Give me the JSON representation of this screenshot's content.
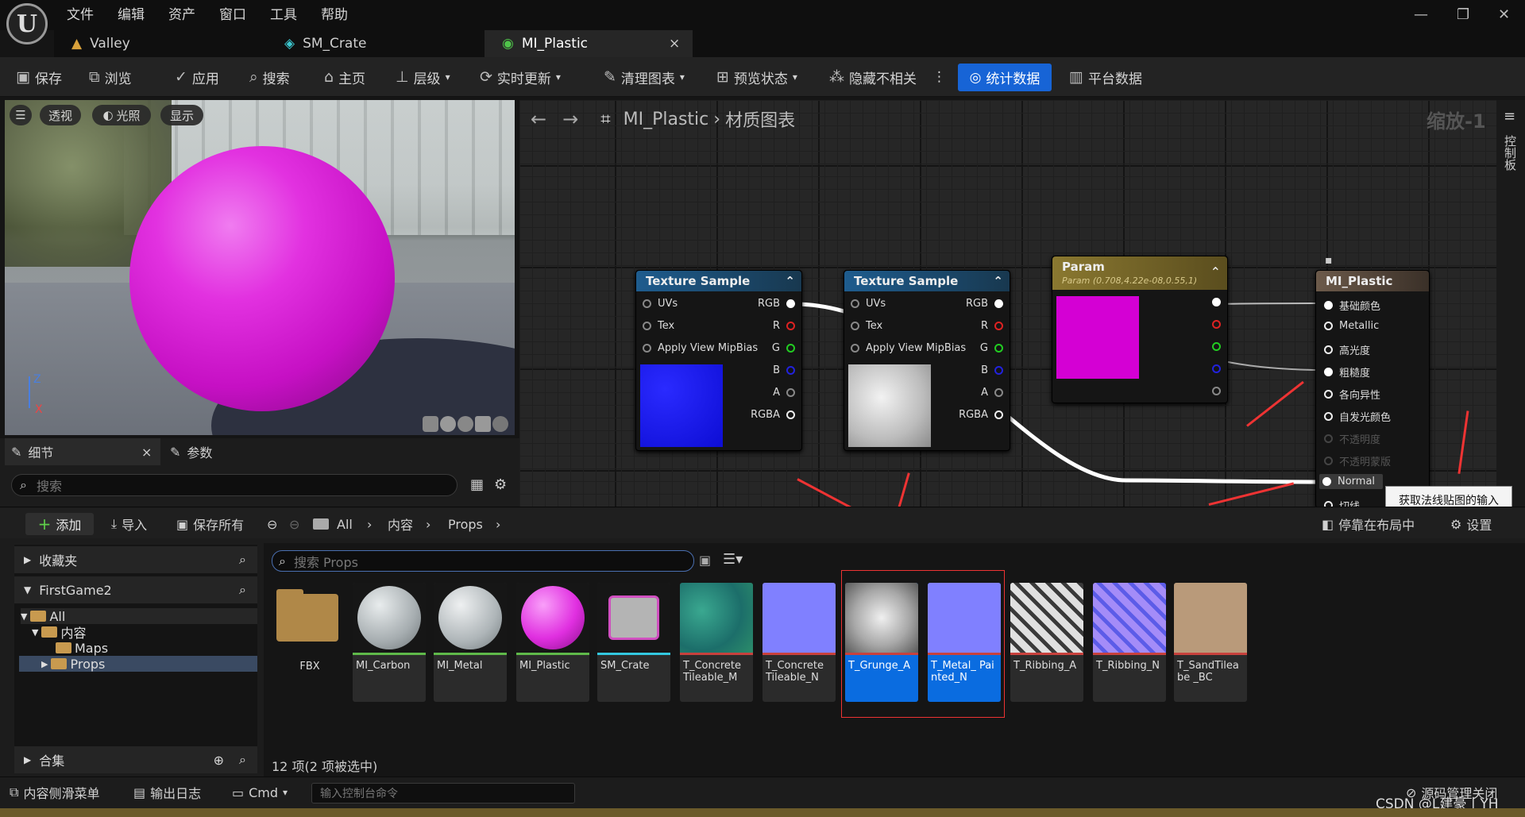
{
  "menu": [
    "文件",
    "编辑",
    "资产",
    "窗口",
    "工具",
    "帮助"
  ],
  "tabs": [
    {
      "label": "Valley",
      "icon": "level-icon"
    },
    {
      "label": "SM_Crate",
      "icon": "static-mesh-icon"
    },
    {
      "label": "MI_Plastic",
      "icon": "material-instance-icon",
      "close": "×"
    }
  ],
  "toolbar": {
    "save": "保存",
    "browse": "浏览",
    "apply": "应用",
    "search": "搜索",
    "home": "主页",
    "hierarchy": "层级",
    "live_update": "实时更新",
    "clean_graph": "清理图表",
    "preview_state": "预览状态",
    "hide_unrelated": "隐藏不相关",
    "more": "⋮",
    "stats": "统计数据",
    "platform_stats": "平台数据"
  },
  "viewport": {
    "menu": "☰",
    "perspective": "透视",
    "lighting": "光照",
    "show": "显示",
    "axis_z": "Z",
    "axis_x": "X"
  },
  "details": {
    "tab": "细节",
    "close": "×",
    "params_tab": "参数",
    "search_placeholder": "搜索"
  },
  "graph": {
    "breadcrumb_asset": "MI_Plastic",
    "breadcrumb_sep": "›",
    "breadcrumb_graph": "材质图表",
    "zoom": "缩放-1",
    "side_label": "控制板",
    "nodes": [
      {
        "title": "Texture Sample",
        "inputs": [
          "UVs",
          "Tex",
          "Apply View MipBias"
        ],
        "outputs": [
          "RGB",
          "R",
          "G",
          "B",
          "A",
          "RGBA"
        ],
        "preview": "#1414e6"
      },
      {
        "title": "Texture Sample",
        "inputs": [
          "UVs",
          "Tex",
          "Apply View MipBias"
        ],
        "outputs": [
          "RGB",
          "R",
          "G",
          "B",
          "A",
          "RGBA"
        ],
        "preview": "#d8d8d8"
      },
      {
        "title": "Param",
        "subtitle": "Param (0.708,4.22e-08,0.55,1)",
        "preview": "#d400d4"
      },
      {
        "title": "MI_Plastic",
        "inputs": [
          "基础颜色",
          "Metallic",
          "高光度",
          "粗糙度",
          "各向异性",
          "自发光颜色",
          "不透明度",
          "不透明蒙版",
          "Normal",
          "切线"
        ]
      }
    ]
  },
  "tooltip": "获取法线贴图的输入",
  "content_browser": {
    "add": "添加",
    "import": "导入",
    "save_all": "保存所有",
    "path": [
      "All",
      "内容",
      "Props"
    ],
    "path_sep": "›",
    "dock": "停靠在布局中",
    "settings": "设置",
    "favorites": "收藏夹",
    "project": "FirstGame2",
    "tree": [
      "All",
      "内容",
      "Maps",
      "Props"
    ],
    "collections": "合集",
    "search_placeholder": "搜索 Props",
    "status": "12 项(2 项被选中)",
    "assets": [
      {
        "name": "FBX",
        "type": "folder"
      },
      {
        "name": "MI_Carbon",
        "color": "#b5bcbe",
        "bar": "#5fb94a"
      },
      {
        "name": "MI_Metal",
        "color": "#b9c0c2",
        "bar": "#5fb94a"
      },
      {
        "name": "MI_Plastic",
        "color": "#e02fe0",
        "bar": "#5fb94a"
      },
      {
        "name": "SM_Crate",
        "color": "#b9b9b9",
        "bar": "#33c8e0"
      },
      {
        "name": "T_Concrete Tileable_M",
        "color": "#2f8c7a",
        "bar": "#c8413d"
      },
      {
        "name": "T_Concrete Tileable_N",
        "color": "#8080ff",
        "bar": "#c8413d"
      },
      {
        "name": "T_Grunge_A",
        "color": "#cfcfcf",
        "bar": "#c8413d",
        "selected": true
      },
      {
        "name": "T_Metal_ Painted_N",
        "color": "#8080ff",
        "bar": "#c8413d",
        "selected": true
      },
      {
        "name": "T_Ribbing_A",
        "color": "#9a9a9a",
        "bar": "#c8413d"
      },
      {
        "name": "T_Ribbing_N",
        "color": "#8a88f0",
        "bar": "#c8413d"
      },
      {
        "name": "T_SandTileabe _BC",
        "color": "#b99a7a",
        "bar": "#c8413d"
      }
    ]
  },
  "statusbar": {
    "drawer": "内容侧滑菜单",
    "output_log": "输出日志",
    "cmd": "Cmd",
    "cmd_placeholder": "输入控制台命令",
    "source_control": "源码管理关闭",
    "watermark": "CSDN @L建豪丨YH"
  }
}
